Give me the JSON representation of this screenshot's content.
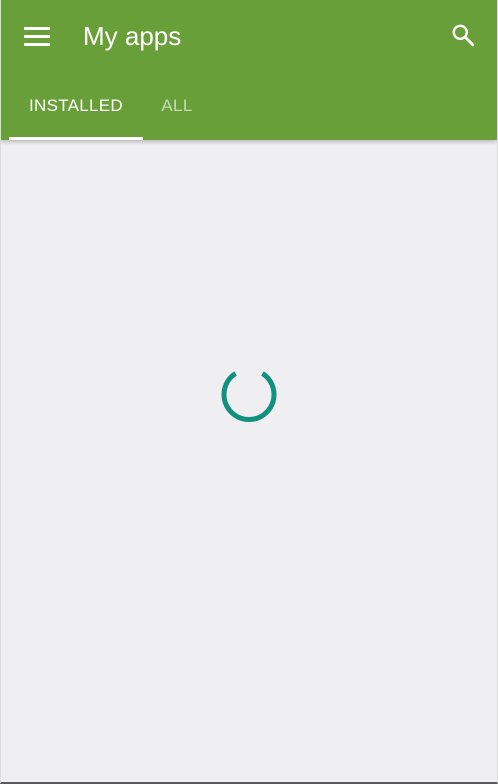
{
  "colors": {
    "appbar": "#689f38",
    "background": "#efeef1",
    "spinner": "#0f9080"
  },
  "toolbar": {
    "title": "My apps",
    "menu_icon": "hamburger-menu-icon",
    "search_icon": "search-icon"
  },
  "tabs": [
    {
      "label": "INSTALLED",
      "selected": true
    },
    {
      "label": "ALL",
      "selected": false
    }
  ],
  "content": {
    "state": "loading",
    "spinner_icon": "loading-spinner-icon"
  }
}
